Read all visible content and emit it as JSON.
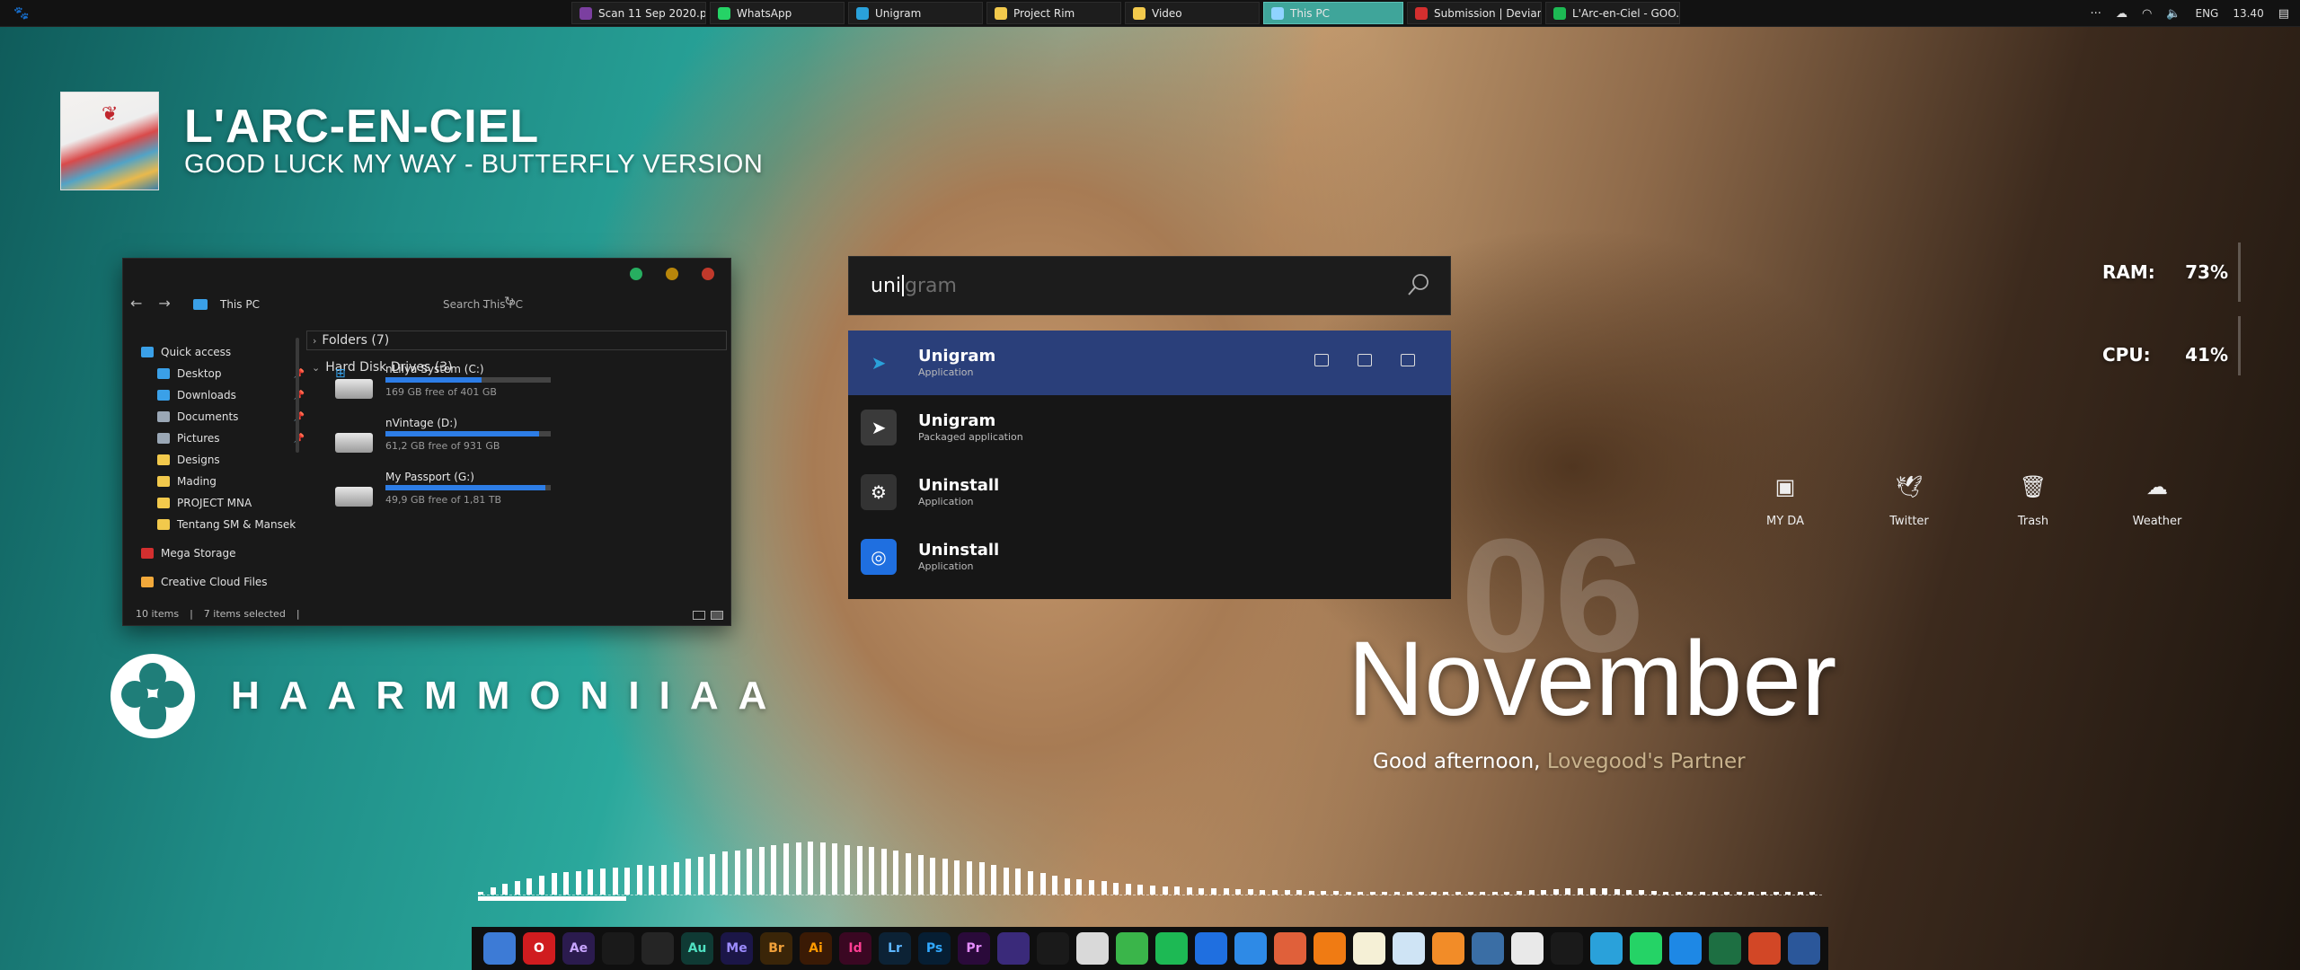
{
  "taskbar": {
    "start_icon": "paw-icon",
    "tasks": [
      {
        "label": "Scan 11 Sep 2020.pdf...",
        "color": "#7b3fa0",
        "width": 150
      },
      {
        "label": "WhatsApp",
        "color": "#25d366",
        "width": 150
      },
      {
        "label": "Unigram",
        "color": "#2aa1da",
        "width": 150
      },
      {
        "label": "Project Rim",
        "color": "#f2c94c",
        "width": 150
      },
      {
        "label": "Video",
        "color": "#f2c94c",
        "width": 150
      },
      {
        "label": "This PC",
        "color": "#8fd3ff",
        "width": 156,
        "active": true
      },
      {
        "label": "Submission | Deviant...",
        "color": "#d32f2f",
        "width": 150
      },
      {
        "label": "L'Arc-en-Ciel - GOO...",
        "color": "#1db954",
        "width": 150
      }
    ],
    "tray": {
      "language": "ENG",
      "time": "13.40"
    }
  },
  "music": {
    "artist": "L'ARC-EN-CIEL",
    "title": "GOOD LUCK MY WAY - BUTTERFLY VERSION"
  },
  "explorer": {
    "title_bar": {
      "close_color": "#c0392b",
      "minimize_color": "#b8860b",
      "maximize_color": "#27ae60"
    },
    "path": "This PC",
    "search_placeholder": "Search This PC",
    "sidebar": [
      {
        "label": "Quick access",
        "color": "#3aa0e8",
        "child": false
      },
      {
        "label": "Desktop",
        "color": "#3aa0e8",
        "child": true,
        "pinned": true
      },
      {
        "label": "Downloads",
        "color": "#3aa0e8",
        "child": true,
        "pinned": true
      },
      {
        "label": "Documents",
        "color": "#9aa7b5",
        "child": true,
        "pinned": true
      },
      {
        "label": "Pictures",
        "color": "#9aa7b5",
        "child": true,
        "pinned": true
      },
      {
        "label": "Designs",
        "color": "#f2c94c",
        "child": true
      },
      {
        "label": "Mading",
        "color": "#f2c94c",
        "child": true
      },
      {
        "label": "PROJECT MNA",
        "color": "#f2c94c",
        "child": true
      },
      {
        "label": "Tentang SM & Mansek",
        "color": "#f2c94c",
        "child": true
      },
      {
        "label": "Mega Storage",
        "color": "#d32f2f",
        "child": false
      },
      {
        "label": "Creative Cloud Files",
        "color": "#f2a93b",
        "child": false
      }
    ],
    "groups": {
      "folders": "Folders (7)",
      "drives": "Hard Disk Drives (3)"
    },
    "drives": [
      {
        "name": "nLilya System (C:)",
        "free": "169 GB free of 401 GB",
        "used_fraction": 0.58,
        "system": true
      },
      {
        "name": "nVintage (D:)",
        "free": "61,2 GB free of 931 GB",
        "used_fraction": 0.93,
        "system": false
      },
      {
        "name": "My Passport (G:)",
        "free": "49,9 GB free of 1,81 TB",
        "used_fraction": 0.97,
        "system": false
      }
    ],
    "status": {
      "items": "10 items",
      "selected": "7 items selected"
    }
  },
  "brand": {
    "name": "HAARMMONIIAA"
  },
  "launcher": {
    "typed": "uni",
    "suggestion": "gram",
    "results": [
      {
        "name": "Unigram",
        "type": "Application",
        "icon": "telegram-icon",
        "color": "#2aa1da",
        "selected": true
      },
      {
        "name": "Unigram",
        "type": "Packaged application",
        "icon": "telegram-icon",
        "color": "#2aa1da"
      },
      {
        "name": "Uninstall",
        "type": "Application",
        "icon": "uninstall-icon",
        "color": "#333333"
      },
      {
        "name": "Uninstall",
        "type": "Application",
        "icon": "ubisoft-icon",
        "color": "#1f6fe0"
      }
    ]
  },
  "sysmon": {
    "ram_label": "RAM:",
    "ram_value": "73%",
    "cpu_label": "CPU:",
    "cpu_value": "41%"
  },
  "quick_launch": [
    {
      "label": "MY DA",
      "icon": "deviantart-icon"
    },
    {
      "label": "Twitter",
      "icon": "twitter-icon"
    },
    {
      "label": "Trash",
      "icon": "trash-icon"
    },
    {
      "label": "Weather",
      "icon": "cloud-icon"
    }
  ],
  "date": {
    "day": "06",
    "month": "November"
  },
  "greeting": {
    "prefix": "Good afternoon,",
    "name": "Lovegood's Partner"
  },
  "visualizer": {
    "levels": [
      0.05,
      0.12,
      0.18,
      0.22,
      0.28,
      0.32,
      0.36,
      0.38,
      0.4,
      0.42,
      0.44,
      0.46,
      0.46,
      0.5,
      0.48,
      0.5,
      0.55,
      0.6,
      0.64,
      0.68,
      0.72,
      0.75,
      0.78,
      0.8,
      0.84,
      0.86,
      0.88,
      0.9,
      0.88,
      0.86,
      0.84,
      0.82,
      0.8,
      0.78,
      0.74,
      0.7,
      0.66,
      0.62,
      0.6,
      0.58,
      0.56,
      0.54,
      0.5,
      0.46,
      0.44,
      0.4,
      0.36,
      0.32,
      0.28,
      0.26,
      0.24,
      0.22,
      0.2,
      0.18,
      0.16,
      0.15,
      0.14,
      0.13,
      0.12,
      0.11,
      0.1,
      0.1,
      0.09,
      0.09,
      0.08,
      0.08,
      0.07,
      0.07,
      0.06,
      0.06,
      0.06,
      0.05,
      0.05,
      0.05,
      0.05,
      0.05,
      0.04,
      0.04,
      0.04,
      0.04,
      0.04,
      0.04,
      0.04,
      0.04,
      0.05,
      0.06,
      0.07,
      0.08,
      0.09,
      0.1,
      0.1,
      0.1,
      0.1,
      0.09,
      0.08,
      0.07,
      0.06,
      0.05,
      0.05,
      0.04,
      0.04,
      0.04,
      0.04,
      0.04,
      0.04,
      0.04,
      0.04,
      0.04,
      0.04,
      0.04
    ],
    "progress_fraction": 0.11
  },
  "dock": [
    {
      "label": "",
      "icon": "finder-icon",
      "bg": "#3d7bd6",
      "fg": "#fff"
    },
    {
      "label": "O",
      "icon": "opera-icon",
      "bg": "#d01c1f",
      "fg": "#fff"
    },
    {
      "label": "Ae",
      "icon": "after-effects-icon",
      "bg": "#2b1b4e",
      "fg": "#c8a6ff"
    },
    {
      "label": "",
      "icon": "stack-icon",
      "bg": "#1a1a1a",
      "fg": "#4aa3ff"
    },
    {
      "label": "",
      "icon": "lightroom-classic-icon",
      "bg": "#252525",
      "fg": "#f0a040"
    },
    {
      "label": "Au",
      "icon": "audition-icon",
      "bg": "#0f3a34",
      "fg": "#4fe0c1"
    },
    {
      "label": "Me",
      "icon": "media-encoder-icon",
      "bg": "#1b1647",
      "fg": "#9c8cff"
    },
    {
      "label": "Br",
      "icon": "bridge-icon",
      "bg": "#3a2508",
      "fg": "#f0a03a"
    },
    {
      "label": "Ai",
      "icon": "illustrator-icon",
      "bg": "#3a1a05",
      "fg": "#ff9a00"
    },
    {
      "label": "Id",
      "icon": "indesign-icon",
      "bg": "#3a0722",
      "fg": "#ff3d93"
    },
    {
      "label": "Lr",
      "icon": "lightroom-icon",
      "bg": "#0c2235",
      "fg": "#5db6ff"
    },
    {
      "label": "Ps",
      "icon": "photoshop-icon",
      "bg": "#061e33",
      "fg": "#31a8ff"
    },
    {
      "label": "Pr",
      "icon": "premiere-icon",
      "bg": "#2a0a3a",
      "fg": "#e58cff"
    },
    {
      "label": "",
      "icon": "video-player-icon",
      "bg": "#3a2a7a",
      "fg": "#fff"
    },
    {
      "label": "",
      "icon": "kodi-icon",
      "bg": "#1a1a1a",
      "fg": "#1fa9d8"
    },
    {
      "label": "",
      "icon": "network-drive-icon",
      "bg": "#d9d9d9",
      "fg": "#333"
    },
    {
      "label": "",
      "icon": "android-file-icon",
      "bg": "#3ab54a",
      "fg": "#fff"
    },
    {
      "label": "",
      "icon": "spotify-icon",
      "bg": "#1db954",
      "fg": "#000"
    },
    {
      "label": "",
      "icon": "ubisoft-icon",
      "bg": "#1f6fe0",
      "fg": "#fff"
    },
    {
      "label": "",
      "icon": "shield-icon",
      "bg": "#2e8ae6",
      "fg": "#fff"
    },
    {
      "label": "",
      "icon": "guitar-icon",
      "bg": "#e0603a",
      "fg": "#fff"
    },
    {
      "label": "",
      "icon": "vlc-icon",
      "bg": "#f07b13",
      "fg": "#fff"
    },
    {
      "label": "",
      "icon": "notes-icon",
      "bg": "#f5f0d6",
      "fg": "#333"
    },
    {
      "label": "",
      "icon": "image-viewer-icon",
      "bg": "#cfe4f5",
      "fg": "#333"
    },
    {
      "label": "",
      "icon": "books-icon",
      "bg": "#f28c28",
      "fg": "#fff"
    },
    {
      "label": "",
      "icon": "globe-icon",
      "bg": "#3a6ea5",
      "fg": "#fff"
    },
    {
      "label": "",
      "icon": "vk-icon",
      "bg": "#e9e9e9",
      "fg": "#1f8c86"
    },
    {
      "label": "",
      "icon": "nvidia-icon",
      "bg": "#1a1a1a",
      "fg": "#76b900"
    },
    {
      "label": "",
      "icon": "telegram-icon",
      "bg": "#2aa1da",
      "fg": "#fff"
    },
    {
      "label": "",
      "icon": "whatsapp-icon",
      "bg": "#25d366",
      "fg": "#fff"
    },
    {
      "label": "",
      "icon": "calculator-icon",
      "bg": "#1e88e5",
      "fg": "#fff"
    },
    {
      "label": "",
      "icon": "excel-icon",
      "bg": "#1d6f42",
      "fg": "#fff"
    },
    {
      "label": "",
      "icon": "powerpoint-icon",
      "bg": "#d24726",
      "fg": "#fff"
    },
    {
      "label": "",
      "icon": "word-icon",
      "bg": "#2b579a",
      "fg": "#fff"
    }
  ]
}
